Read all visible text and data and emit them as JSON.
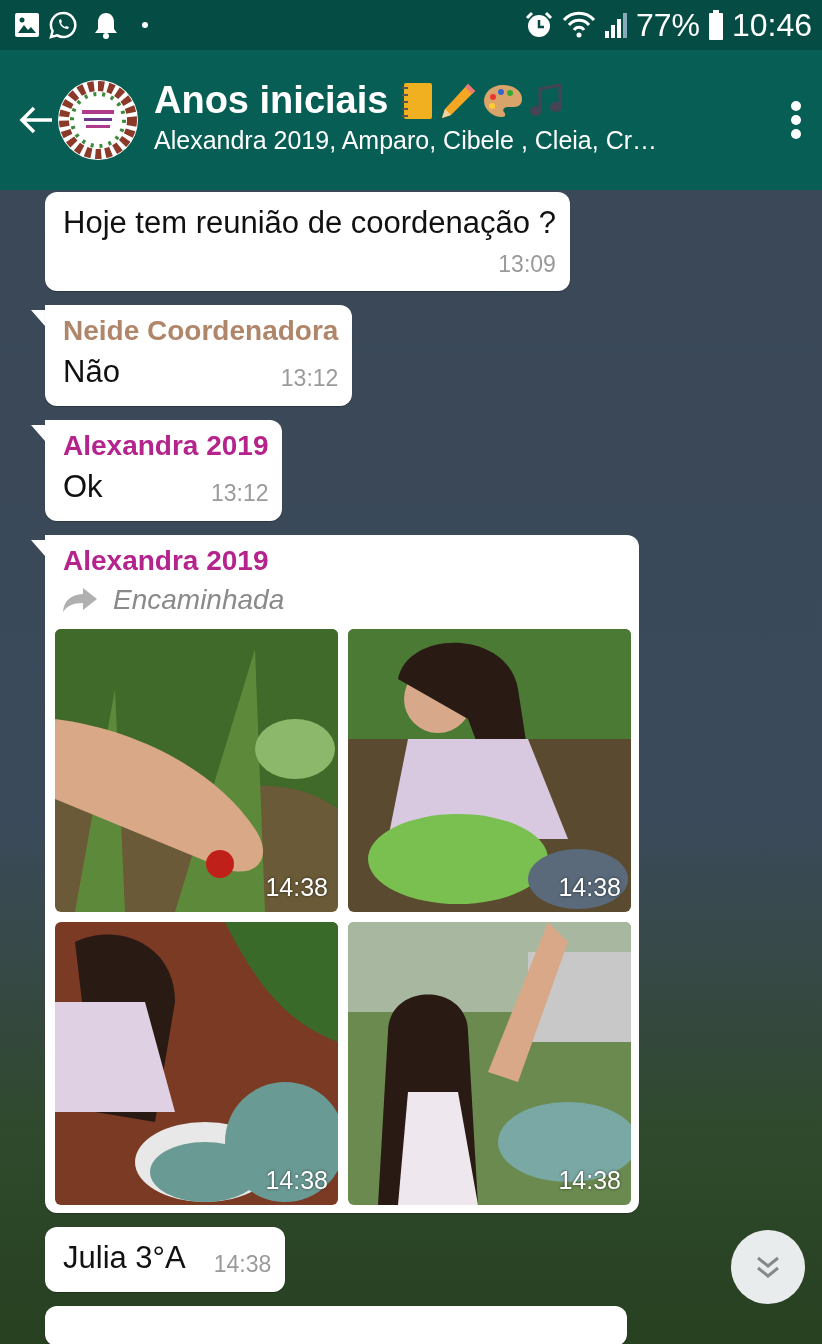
{
  "status_bar": {
    "battery": "77%",
    "time": "10:46"
  },
  "header": {
    "title": "Anos iniciais",
    "subtitle": "Alexandra 2019, Amparo, Cibele , Cleia, Cr…"
  },
  "messages": [
    {
      "kind": "text",
      "tail": false,
      "text": "Hoje tem reunião de coordenação ?",
      "time": "13:09"
    },
    {
      "kind": "text",
      "tail": true,
      "sender": "Neide Coordenadora",
      "color": "#b0866a",
      "text": "Não",
      "time": "13:12"
    },
    {
      "kind": "text",
      "tail": true,
      "sender": "Alexandra 2019",
      "color": "#b5238c",
      "text": "Ok",
      "time": "13:12"
    },
    {
      "kind": "album",
      "tail": true,
      "sender": "Alexandra 2019",
      "color": "#b5238c",
      "forwarded": "Encaminhada",
      "photos": [
        {
          "kind": "picture",
          "time": "14:38"
        },
        {
          "kind": "picture",
          "time": "14:38"
        },
        {
          "kind": "picture",
          "time": "14:38"
        },
        {
          "kind": "picture",
          "time": "14:38"
        }
      ]
    },
    {
      "kind": "text",
      "tail": false,
      "text": "Julia 3°A",
      "time": "14:38"
    },
    {
      "kind": "cut",
      "tail": false
    }
  ]
}
